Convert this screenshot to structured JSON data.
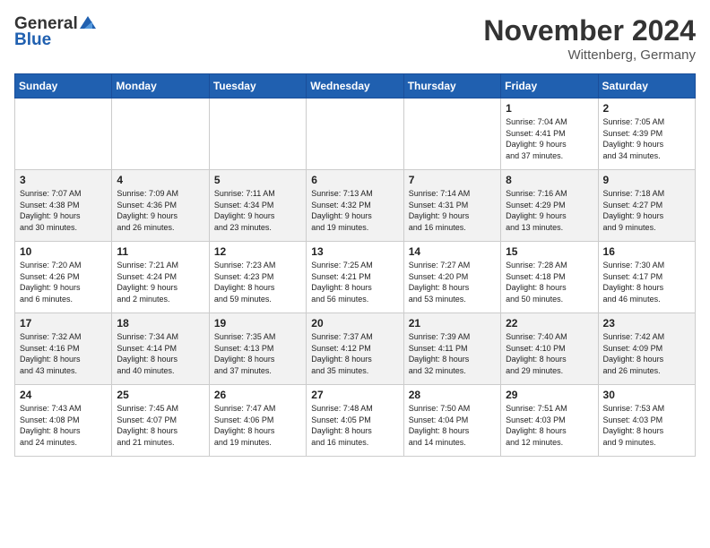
{
  "header": {
    "logo_general": "General",
    "logo_blue": "Blue",
    "month_title": "November 2024",
    "location": "Wittenberg, Germany"
  },
  "weekdays": [
    "Sunday",
    "Monday",
    "Tuesday",
    "Wednesday",
    "Thursday",
    "Friday",
    "Saturday"
  ],
  "weeks": [
    [
      {
        "day": "",
        "info": ""
      },
      {
        "day": "",
        "info": ""
      },
      {
        "day": "",
        "info": ""
      },
      {
        "day": "",
        "info": ""
      },
      {
        "day": "",
        "info": ""
      },
      {
        "day": "1",
        "info": "Sunrise: 7:04 AM\nSunset: 4:41 PM\nDaylight: 9 hours\nand 37 minutes."
      },
      {
        "day": "2",
        "info": "Sunrise: 7:05 AM\nSunset: 4:39 PM\nDaylight: 9 hours\nand 34 minutes."
      }
    ],
    [
      {
        "day": "3",
        "info": "Sunrise: 7:07 AM\nSunset: 4:38 PM\nDaylight: 9 hours\nand 30 minutes."
      },
      {
        "day": "4",
        "info": "Sunrise: 7:09 AM\nSunset: 4:36 PM\nDaylight: 9 hours\nand 26 minutes."
      },
      {
        "day": "5",
        "info": "Sunrise: 7:11 AM\nSunset: 4:34 PM\nDaylight: 9 hours\nand 23 minutes."
      },
      {
        "day": "6",
        "info": "Sunrise: 7:13 AM\nSunset: 4:32 PM\nDaylight: 9 hours\nand 19 minutes."
      },
      {
        "day": "7",
        "info": "Sunrise: 7:14 AM\nSunset: 4:31 PM\nDaylight: 9 hours\nand 16 minutes."
      },
      {
        "day": "8",
        "info": "Sunrise: 7:16 AM\nSunset: 4:29 PM\nDaylight: 9 hours\nand 13 minutes."
      },
      {
        "day": "9",
        "info": "Sunrise: 7:18 AM\nSunset: 4:27 PM\nDaylight: 9 hours\nand 9 minutes."
      }
    ],
    [
      {
        "day": "10",
        "info": "Sunrise: 7:20 AM\nSunset: 4:26 PM\nDaylight: 9 hours\nand 6 minutes."
      },
      {
        "day": "11",
        "info": "Sunrise: 7:21 AM\nSunset: 4:24 PM\nDaylight: 9 hours\nand 2 minutes."
      },
      {
        "day": "12",
        "info": "Sunrise: 7:23 AM\nSunset: 4:23 PM\nDaylight: 8 hours\nand 59 minutes."
      },
      {
        "day": "13",
        "info": "Sunrise: 7:25 AM\nSunset: 4:21 PM\nDaylight: 8 hours\nand 56 minutes."
      },
      {
        "day": "14",
        "info": "Sunrise: 7:27 AM\nSunset: 4:20 PM\nDaylight: 8 hours\nand 53 minutes."
      },
      {
        "day": "15",
        "info": "Sunrise: 7:28 AM\nSunset: 4:18 PM\nDaylight: 8 hours\nand 50 minutes."
      },
      {
        "day": "16",
        "info": "Sunrise: 7:30 AM\nSunset: 4:17 PM\nDaylight: 8 hours\nand 46 minutes."
      }
    ],
    [
      {
        "day": "17",
        "info": "Sunrise: 7:32 AM\nSunset: 4:16 PM\nDaylight: 8 hours\nand 43 minutes."
      },
      {
        "day": "18",
        "info": "Sunrise: 7:34 AM\nSunset: 4:14 PM\nDaylight: 8 hours\nand 40 minutes."
      },
      {
        "day": "19",
        "info": "Sunrise: 7:35 AM\nSunset: 4:13 PM\nDaylight: 8 hours\nand 37 minutes."
      },
      {
        "day": "20",
        "info": "Sunrise: 7:37 AM\nSunset: 4:12 PM\nDaylight: 8 hours\nand 35 minutes."
      },
      {
        "day": "21",
        "info": "Sunrise: 7:39 AM\nSunset: 4:11 PM\nDaylight: 8 hours\nand 32 minutes."
      },
      {
        "day": "22",
        "info": "Sunrise: 7:40 AM\nSunset: 4:10 PM\nDaylight: 8 hours\nand 29 minutes."
      },
      {
        "day": "23",
        "info": "Sunrise: 7:42 AM\nSunset: 4:09 PM\nDaylight: 8 hours\nand 26 minutes."
      }
    ],
    [
      {
        "day": "24",
        "info": "Sunrise: 7:43 AM\nSunset: 4:08 PM\nDaylight: 8 hours\nand 24 minutes."
      },
      {
        "day": "25",
        "info": "Sunrise: 7:45 AM\nSunset: 4:07 PM\nDaylight: 8 hours\nand 21 minutes."
      },
      {
        "day": "26",
        "info": "Sunrise: 7:47 AM\nSunset: 4:06 PM\nDaylight: 8 hours\nand 19 minutes."
      },
      {
        "day": "27",
        "info": "Sunrise: 7:48 AM\nSunset: 4:05 PM\nDaylight: 8 hours\nand 16 minutes."
      },
      {
        "day": "28",
        "info": "Sunrise: 7:50 AM\nSunset: 4:04 PM\nDaylight: 8 hours\nand 14 minutes."
      },
      {
        "day": "29",
        "info": "Sunrise: 7:51 AM\nSunset: 4:03 PM\nDaylight: 8 hours\nand 12 minutes."
      },
      {
        "day": "30",
        "info": "Sunrise: 7:53 AM\nSunset: 4:03 PM\nDaylight: 8 hours\nand 9 minutes."
      }
    ]
  ]
}
